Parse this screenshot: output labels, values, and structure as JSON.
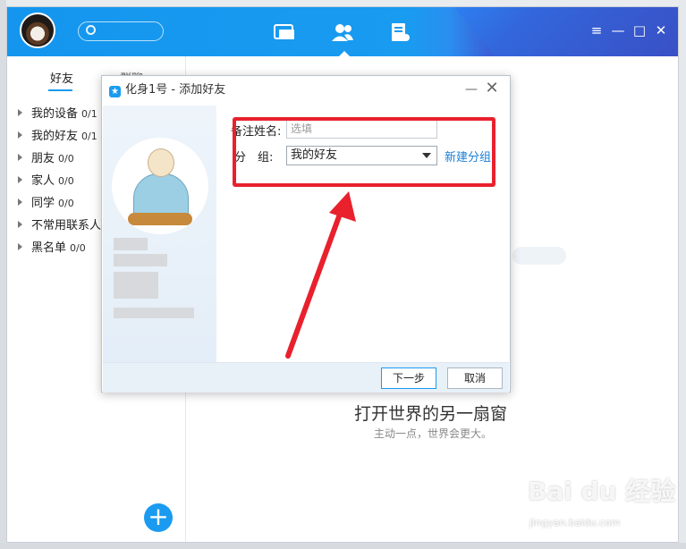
{
  "main_window": {
    "tabs": [
      {
        "icon": "message-icon"
      },
      {
        "icon": "contacts-icon",
        "active": true
      },
      {
        "icon": "space-icon"
      }
    ],
    "window_controls": {
      "menu": "≡",
      "minimize": "—",
      "maximize": "□",
      "close": "✕"
    },
    "sidebar": {
      "tabs": [
        {
          "label": "好友",
          "active": true
        },
        {
          "label": "群聊"
        }
      ],
      "groups": [
        {
          "name": "我的设备",
          "count": "0/1"
        },
        {
          "name": "我的好友",
          "count": "0/1"
        },
        {
          "name": "朋友",
          "count": "0/0"
        },
        {
          "name": "家人",
          "count": "0/0"
        },
        {
          "name": "同学",
          "count": "0/0"
        },
        {
          "name": "不常用联系人",
          "count": ""
        },
        {
          "name": "黑名单",
          "count": "0/0"
        }
      ],
      "add_button": "+"
    },
    "slogan": "打开世界的另一扇窗",
    "slogan_sub": "主动一点，世界会更大。"
  },
  "dialog": {
    "title": "化身1号 - 添加好友",
    "remark_label": "备注姓名:",
    "remark_placeholder": "选填",
    "group_label": "分　组:",
    "group_value": "我的好友",
    "new_group_link": "新建分组",
    "next_button": "下一步",
    "cancel_button": "取消"
  },
  "watermark": {
    "brand": "Bai du 经验",
    "url": "jingyan.baidu.com"
  },
  "colors": {
    "accent": "#1a9bf0",
    "highlight": "#e8212d"
  }
}
